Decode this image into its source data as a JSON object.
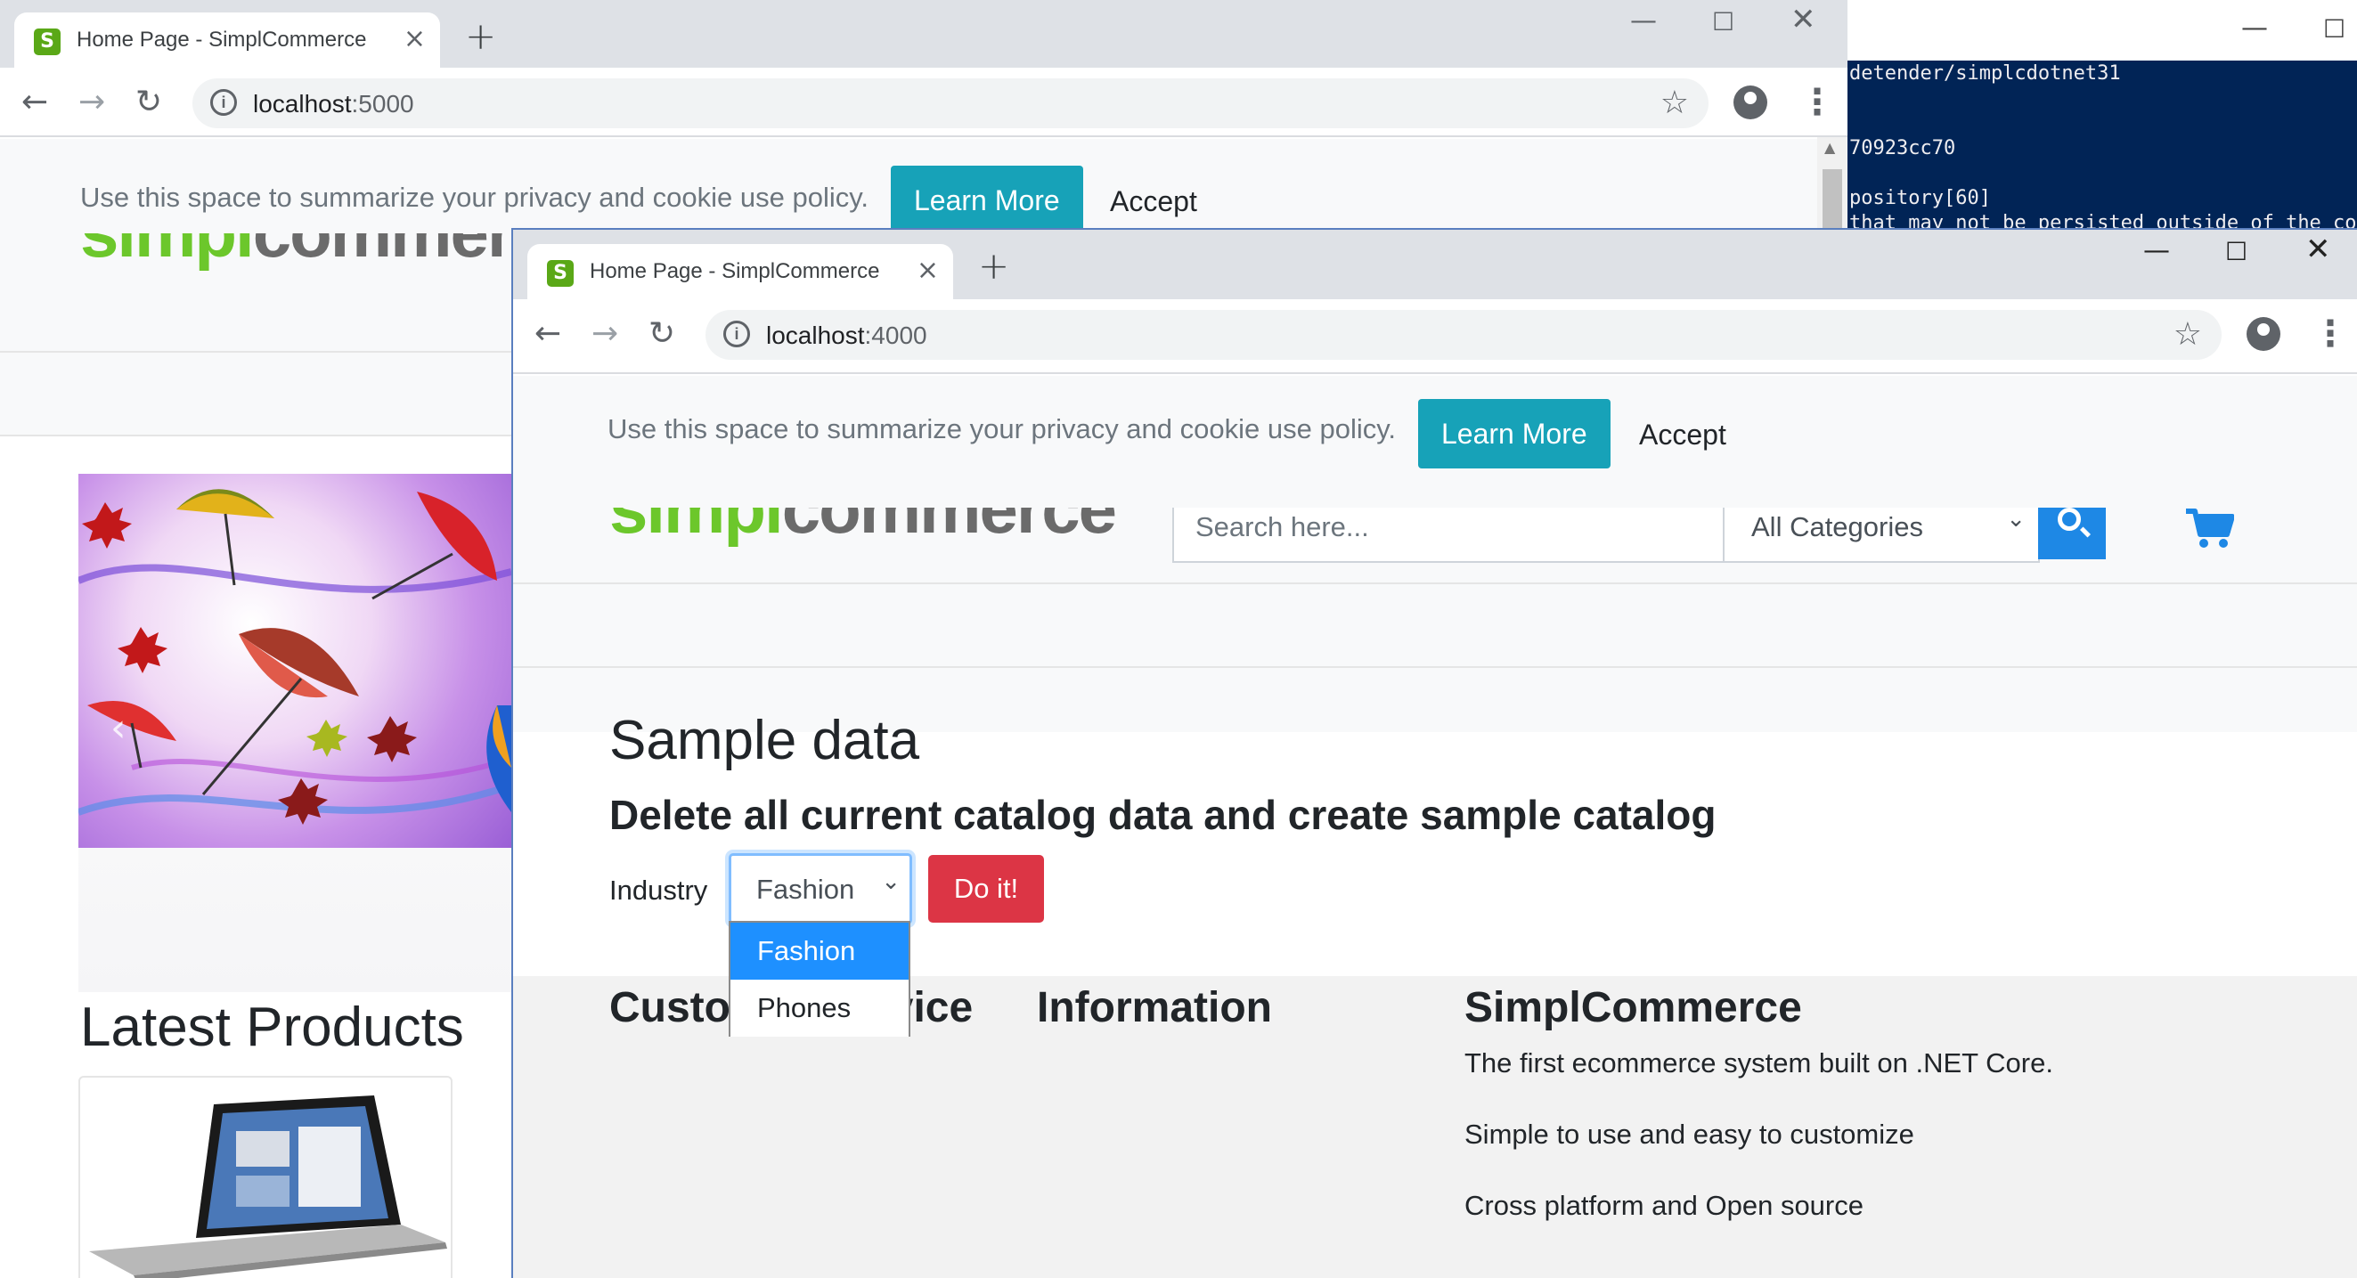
{
  "back_window": {
    "tab": {
      "favicon": "S",
      "title": "Home Page - SimplCommerce",
      "close": "×"
    },
    "new_tab": "+",
    "url": {
      "host": "localhost",
      "port": ":5000"
    },
    "cookie": {
      "text": "Use this space to summarize your privacy and cookie use policy.",
      "learn_more": "Learn More",
      "accept": "Accept"
    },
    "logo": {
      "simpl": "simpl",
      "commerce": "commerce"
    },
    "latest_products": "Latest Products",
    "carousel_prev": "‹"
  },
  "terminal": {
    "lines": [
      "detender/simplcdotnet31",
      "70923cc70",
      "pository[60]",
      "that may not be persisted outside of the con"
    ]
  },
  "front_window": {
    "tab": {
      "favicon": "S",
      "title": "Home Page - SimplCommerce",
      "close": "×"
    },
    "new_tab": "+",
    "url": {
      "host": "localhost",
      "port": ":4000"
    },
    "cookie": {
      "text": "Use this space to summarize your privacy and cookie use policy.",
      "learn_more": "Learn More",
      "accept": "Accept"
    },
    "logo": {
      "simpl": "simpl",
      "commerce": "commerce"
    },
    "search": {
      "placeholder": "Search here..."
    },
    "category": {
      "selected": "All Categories"
    },
    "sample": {
      "title": "Sample data",
      "subtitle": "Delete all current catalog data and create sample catalog",
      "industry_label": "Industry",
      "industry_selected": "Fashion",
      "industry_options": [
        "Fashion",
        "Phones"
      ],
      "do_it": "Do it!"
    },
    "footer": {
      "customer_service": "Customer Service",
      "information": "Information",
      "simplcommerce": "SimplCommerce",
      "lines": [
        "The first ecommerce system built on .NET Core.",
        "Simple to use and easy to customize",
        "Cross platform and Open source"
      ]
    }
  },
  "colors": {
    "brand_green": "#6cc72b",
    "learn_more": "#17a2b8",
    "danger": "#dc3545",
    "primary_blue": "#1e88e5",
    "terminal_bg": "#012456"
  }
}
